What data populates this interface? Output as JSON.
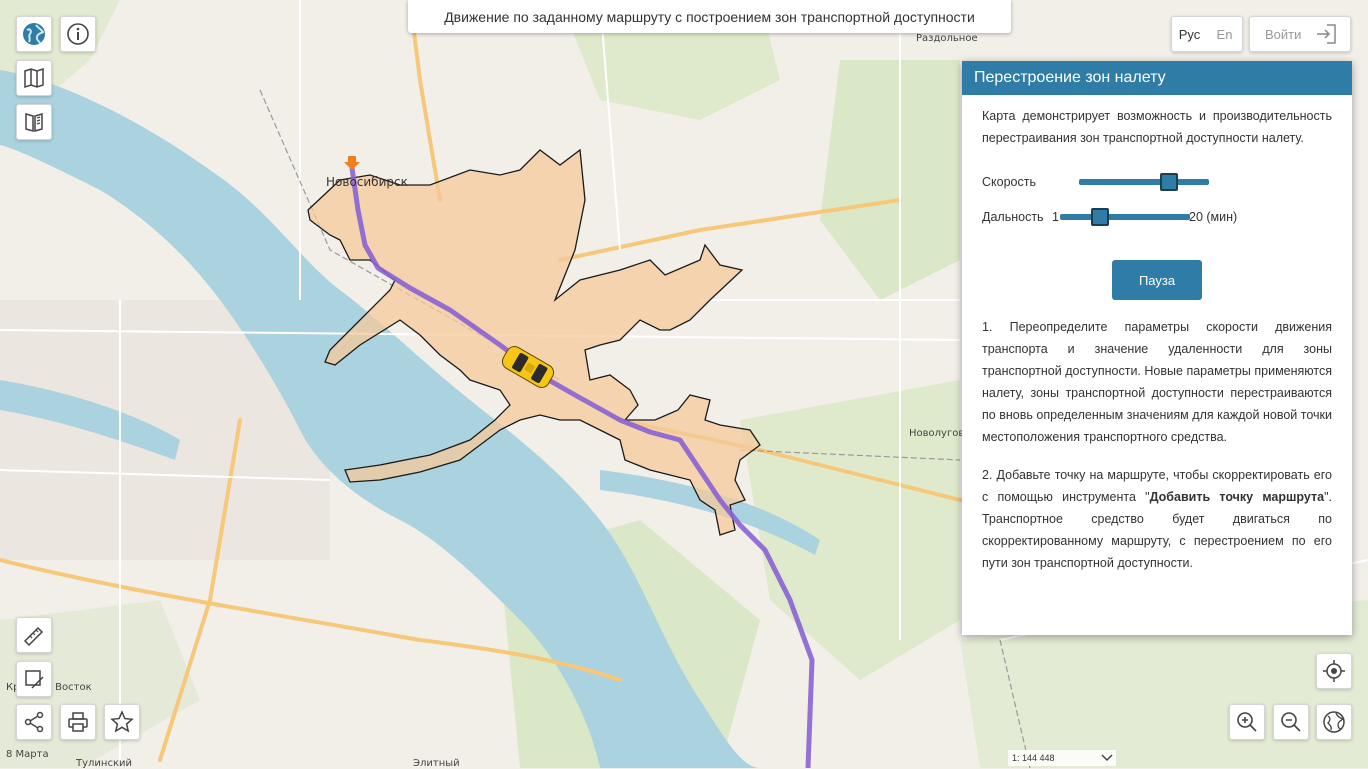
{
  "header": {
    "title": "Движение по заданному маршруту с построением зон транспортной доступности"
  },
  "lang": {
    "ru": "Рус",
    "en": "En"
  },
  "login": {
    "label": "Войти"
  },
  "map_labels": {
    "novosibirsk": "Новосибирск",
    "razdolnoe": "Раздольное",
    "novolugovoe": "Новолуговое",
    "krasny_vostok": "Красный Восток",
    "march8": "8 Марта",
    "tulinsky": "Тулинский",
    "elitny": "Элитный"
  },
  "panel": {
    "title": "Перестроение зон налету",
    "intro": "Карта демонстрирует возможность и производительность перестраивания зон транспортной доступности налету.",
    "speed_label": "Скорость",
    "range_label": "Дальность",
    "range_min": "1",
    "range_max": "20 (мин)",
    "speed_value": 0.72,
    "range_value": 0.28,
    "pause_button": "Пауза",
    "step1": "1. Переопределите параметры скорости движения транспорта и значение удаленности для зоны транспортной доступности. Новые параметры применяются налету, зоны транспортной доступности перестраиваются по вновь определенным значениям для каждой новой точки местоположения транспортного средства.",
    "step2_a": "2. Добавьте точку на маршруте, чтобы скорректировать его с помощью инструмента \"",
    "step2_bold": "Добавить точку маршрута",
    "step2_b": "\". Транспортное средство будет двигаться по скорректированному маршруту, с перестроением по его пути зон транспортной доступности."
  },
  "scale": {
    "label": "1: 144 448"
  },
  "icons": [
    "globe-icon",
    "info-icon",
    "map-icon",
    "book-icon",
    "ruler-icon",
    "area-measure-icon",
    "share-icon",
    "print-icon",
    "star-icon",
    "locate-icon",
    "zoom-in-icon",
    "zoom-out-icon",
    "world-icon",
    "login-icon",
    "chevron-down-icon"
  ],
  "colors": {
    "accent": "#2f7da6",
    "zone": "#f5c99b",
    "route": "#8a63d2",
    "water": "#aad3df"
  }
}
